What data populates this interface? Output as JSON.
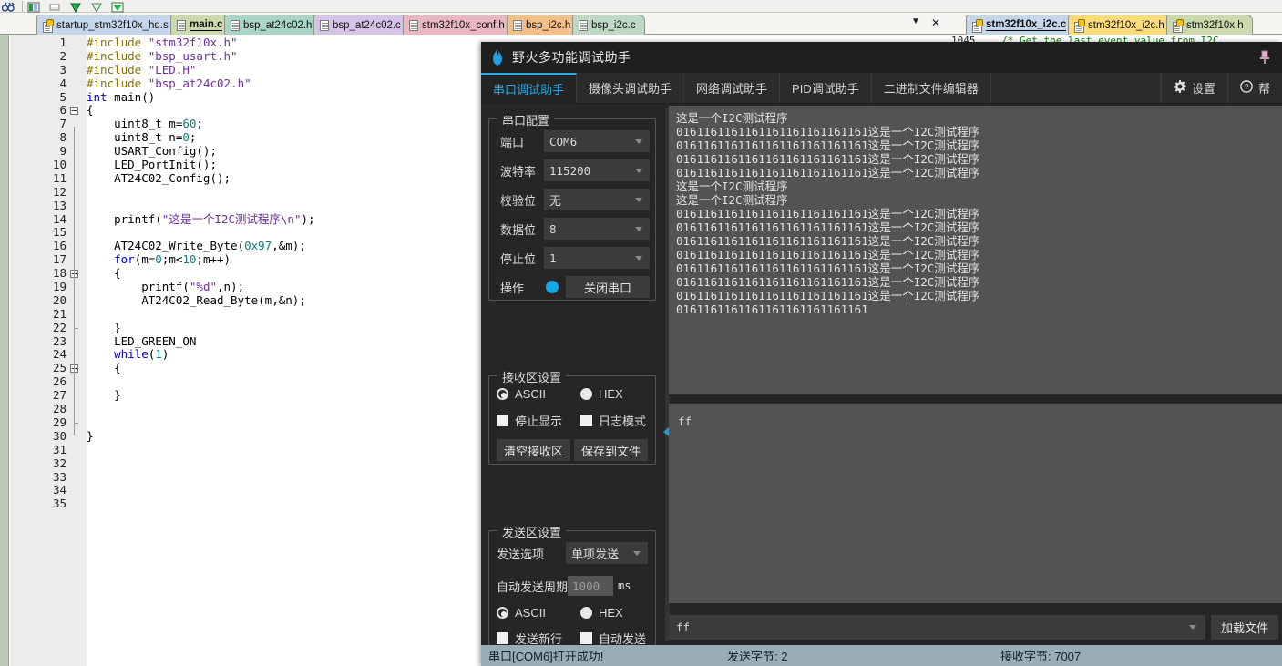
{
  "ide": {
    "toolbar_icons": [
      "binoculars-icon",
      "bookmark-icon",
      "clear-bookmark-icon",
      "next-bookmark-icon",
      "prev-bookmark-icon",
      "all-bookmarks-icon"
    ],
    "left_tabs": [
      {
        "label": "startup_stm32f10x_hd.s",
        "icon": "key-file-icon",
        "active": false,
        "color": "#c6d6ea"
      },
      {
        "label": "main.c",
        "icon": "document-icon",
        "active": true,
        "color": "#ccd9ae"
      },
      {
        "label": "bsp_at24c02.h",
        "icon": "document-icon",
        "active": false,
        "color": "#a9d4c6"
      },
      {
        "label": "bsp_at24c02.c",
        "icon": "document-icon",
        "active": false,
        "color": "#d6c4e8"
      },
      {
        "label": "stm32f10x_conf.h",
        "icon": "document-icon",
        "active": false,
        "color": "#e8b7c2"
      },
      {
        "label": "bsp_i2c.h",
        "icon": "document-icon",
        "active": false,
        "color": "#f4c08a"
      },
      {
        "label": "bsp_i2c.c",
        "icon": "document-icon",
        "active": false,
        "color": "#bfd8c4"
      }
    ],
    "tabstrip_controls": [
      "chevron-down-icon",
      "close-icon"
    ],
    "chevron_glyph": "▼",
    "close_glyph": "✕",
    "right_tabs": [
      {
        "label": "stm32f10x_i2c.c",
        "icon": "key-file-icon",
        "active": true,
        "color": "#c6d6ea"
      },
      {
        "label": "stm32f10x_i2c.h",
        "icon": "key-file-icon",
        "active": false,
        "color": "#fbdb7a"
      },
      {
        "label": "stm32f10x.h",
        "icon": "key-file-icon",
        "active": false,
        "color": "#ccd9ae"
      }
    ],
    "right_code_line_no": "1045",
    "right_code_text": "/* Get the last event value from I2C",
    "code_lines": [
      {
        "n": "1",
        "segs": [
          {
            "t": "#include ",
            "c": "pre"
          },
          {
            "t": "\"stm32f10x.h\"",
            "c": "str"
          }
        ]
      },
      {
        "n": "2",
        "segs": [
          {
            "t": "#include ",
            "c": "pre"
          },
          {
            "t": "\"bsp_usart.h\"",
            "c": "str"
          }
        ]
      },
      {
        "n": "3",
        "segs": [
          {
            "t": "#include ",
            "c": "pre"
          },
          {
            "t": "\"LED.H\"",
            "c": "str"
          }
        ]
      },
      {
        "n": "4",
        "segs": [
          {
            "t": "#include ",
            "c": "pre"
          },
          {
            "t": "\"bsp_at24c02.h\"",
            "c": "str"
          }
        ]
      },
      {
        "n": "5",
        "segs": [
          {
            "t": "int ",
            "c": "kw"
          },
          {
            "t": "main()",
            "c": ""
          }
        ]
      },
      {
        "n": "6",
        "segs": [
          {
            "t": "{",
            "c": ""
          }
        ],
        "fold": "open"
      },
      {
        "n": "7",
        "segs": [
          {
            "t": "    uint8_t m=",
            "c": ""
          },
          {
            "t": "60",
            "c": "num"
          },
          {
            "t": ";",
            "c": ""
          }
        ]
      },
      {
        "n": "8",
        "segs": [
          {
            "t": "    uint8_t n=",
            "c": ""
          },
          {
            "t": "0",
            "c": "num"
          },
          {
            "t": ";",
            "c": ""
          }
        ]
      },
      {
        "n": "9",
        "segs": [
          {
            "t": "    USART_Config();",
            "c": ""
          }
        ]
      },
      {
        "n": "10",
        "segs": [
          {
            "t": "    LED_PortInit();",
            "c": ""
          }
        ]
      },
      {
        "n": "11",
        "segs": [
          {
            "t": "    AT24C02_Config();",
            "c": ""
          }
        ]
      },
      {
        "n": "12",
        "segs": []
      },
      {
        "n": "13",
        "segs": []
      },
      {
        "n": "14",
        "segs": [
          {
            "t": "    printf(",
            "c": ""
          },
          {
            "t": "\"这是一个I2C测试程序\\n\"",
            "c": "str"
          },
          {
            "t": ");",
            "c": ""
          }
        ]
      },
      {
        "n": "15",
        "segs": []
      },
      {
        "n": "16",
        "segs": [
          {
            "t": "    AT24C02_Write_Byte(",
            "c": ""
          },
          {
            "t": "0x97",
            "c": "num"
          },
          {
            "t": ",&m);",
            "c": ""
          }
        ]
      },
      {
        "n": "17",
        "segs": [
          {
            "t": "    ",
            "c": ""
          },
          {
            "t": "for",
            "c": "kw"
          },
          {
            "t": "(m=",
            "c": ""
          },
          {
            "t": "0",
            "c": "num"
          },
          {
            "t": ";m<",
            "c": ""
          },
          {
            "t": "10",
            "c": "num"
          },
          {
            "t": ";m++)",
            "c": ""
          }
        ]
      },
      {
        "n": "18",
        "segs": [
          {
            "t": "    {",
            "c": ""
          }
        ],
        "fold": "open"
      },
      {
        "n": "19",
        "segs": [
          {
            "t": "        printf(",
            "c": ""
          },
          {
            "t": "\"%d\"",
            "c": "str"
          },
          {
            "t": ",n);",
            "c": ""
          }
        ]
      },
      {
        "n": "20",
        "segs": [
          {
            "t": "        AT24C02_Read_Byte(m,&n);",
            "c": ""
          }
        ]
      },
      {
        "n": "21",
        "segs": []
      },
      {
        "n": "22",
        "segs": [
          {
            "t": "    }",
            "c": ""
          },
          {
            "t": "",
            "c": ""
          }
        ],
        "fold": "tick"
      },
      {
        "n": "23",
        "segs": [
          {
            "t": "    LED_GREEN_ON",
            "c": ""
          }
        ]
      },
      {
        "n": "24",
        "segs": [
          {
            "t": "    ",
            "c": ""
          },
          {
            "t": "while",
            "c": "kw"
          },
          {
            "t": "(",
            "c": ""
          },
          {
            "t": "1",
            "c": "num"
          },
          {
            "t": ")",
            "c": ""
          }
        ]
      },
      {
        "n": "25",
        "segs": [
          {
            "t": "    {",
            "c": ""
          }
        ],
        "fold": "open"
      },
      {
        "n": "26",
        "segs": []
      },
      {
        "n": "27",
        "segs": [
          {
            "t": "    }",
            "c": ""
          }
        ]
      },
      {
        "n": "28",
        "segs": []
      },
      {
        "n": "29",
        "segs": [],
        "fold": "tick"
      },
      {
        "n": "30",
        "segs": [
          {
            "t": "}",
            "c": ""
          }
        ]
      },
      {
        "n": "31",
        "segs": []
      },
      {
        "n": "32",
        "segs": []
      },
      {
        "n": "33",
        "segs": []
      },
      {
        "n": "34",
        "segs": []
      },
      {
        "n": "35",
        "segs": []
      }
    ]
  },
  "app": {
    "title": "野火多功能调试助手",
    "pin_icon": "pin-icon",
    "tabs": [
      {
        "label": "串口调试助手",
        "active": true
      },
      {
        "label": "摄像头调试助手",
        "active": false
      },
      {
        "label": "网络调试助手",
        "active": false
      },
      {
        "label": "PID调试助手",
        "active": false
      },
      {
        "label": "二进制文件编辑器",
        "active": false
      }
    ],
    "right_tabs": [
      {
        "label": "设置",
        "icon": "gear-icon"
      },
      {
        "label": "帮",
        "icon": "help-icon"
      }
    ],
    "serial_config": {
      "title": "串口配置",
      "rows": [
        {
          "label": "端口",
          "value": "COM6",
          "mono": true
        },
        {
          "label": "波特率",
          "value": "115200",
          "mono": true
        },
        {
          "label": "校验位",
          "value": "无",
          "mono": false
        },
        {
          "label": "数据位",
          "value": "8",
          "mono": true
        },
        {
          "label": "停止位",
          "value": "1",
          "mono": true
        }
      ],
      "action_label": "操作",
      "action_button": "关闭串口",
      "status_dot_color": "#19a7e0"
    },
    "recv_settings": {
      "title": "接收区设置",
      "ascii_label": "ASCII",
      "hex_label": "HEX",
      "ascii_selected": true,
      "stop_display_label": "停止显示",
      "log_mode_label": "日志模式",
      "stop_display_checked": false,
      "log_mode_checked": false,
      "clear_button": "清空接收区",
      "save_button": "保存到文件"
    },
    "send_settings": {
      "title": "发送区设置",
      "send_option_label": "发送选项",
      "send_option_value": "单项发送",
      "auto_period_label": "自动发送周期",
      "auto_period_value": "1000",
      "auto_period_unit": "ms",
      "ascii_label": "ASCII",
      "hex_label": "HEX",
      "ascii_selected": true,
      "newline_label": "发送新行",
      "autosend_label": "自动发送",
      "newline_checked": false,
      "autosend_checked": false
    },
    "receive_area": {
      "lines": [
        "这是一个I2C测试程序",
        "0161161161161161161161161161这是一个I2C测试程序",
        "0161161161161161161161161161这是一个I2C测试程序",
        "0161161161161161161161161161这是一个I2C测试程序",
        "0161161161161161161161161161这是一个I2C测试程序",
        "这是一个I2C测试程序",
        "这是一个I2C测试程序",
        "0161161161161161161161161161这是一个I2C测试程序",
        "0161161161161161161161161161这是一个I2C测试程序",
        "0161161161161161161161161161这是一个I2C测试程序",
        "0161161161161161161161161161这是一个I2C测试程序",
        "0161161161161161161161161161这是一个I2C测试程序",
        "0161161161161161161161161161这是一个I2C测试程序",
        "0161161161161161161161161161这是一个I2C测试程序",
        "0161161161161161161161161161"
      ]
    },
    "send_area": {
      "text": "ff"
    },
    "send_bar": {
      "input_value": "ff",
      "load_button": "加载文件"
    },
    "statusbar": {
      "port_status": "串口[COM6]打开成功!",
      "sent_bytes": "发送字节: 2",
      "recv_bytes": "接收字节: 7007"
    }
  }
}
